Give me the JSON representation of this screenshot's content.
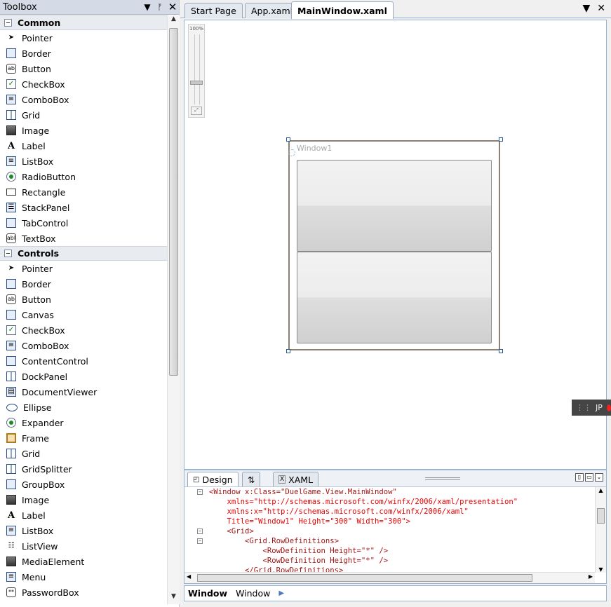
{
  "toolbox": {
    "title": "Toolbox",
    "categories": [
      {
        "name": "Common",
        "items": [
          {
            "label": "Pointer",
            "icon": "pointer-icon"
          },
          {
            "label": "Border",
            "icon": "border-icon"
          },
          {
            "label": "Button",
            "icon": "button-icon"
          },
          {
            "label": "CheckBox",
            "icon": "checkbox-icon"
          },
          {
            "label": "ComboBox",
            "icon": "combobox-icon"
          },
          {
            "label": "Grid",
            "icon": "grid-icon"
          },
          {
            "label": "Image",
            "icon": "image-icon"
          },
          {
            "label": "Label",
            "icon": "label-icon"
          },
          {
            "label": "ListBox",
            "icon": "listbox-icon"
          },
          {
            "label": "RadioButton",
            "icon": "radiobutton-icon"
          },
          {
            "label": "Rectangle",
            "icon": "rectangle-icon"
          },
          {
            "label": "StackPanel",
            "icon": "stackpanel-icon"
          },
          {
            "label": "TabControl",
            "icon": "tabcontrol-icon"
          },
          {
            "label": "TextBox",
            "icon": "textbox-icon"
          }
        ]
      },
      {
        "name": "Controls",
        "items": [
          {
            "label": "Pointer",
            "icon": "pointer-icon"
          },
          {
            "label": "Border",
            "icon": "border-icon"
          },
          {
            "label": "Button",
            "icon": "button-icon"
          },
          {
            "label": "Canvas",
            "icon": "canvas-icon"
          },
          {
            "label": "CheckBox",
            "icon": "checkbox-icon"
          },
          {
            "label": "ComboBox",
            "icon": "combobox-icon"
          },
          {
            "label": "ContentControl",
            "icon": "contentcontrol-icon"
          },
          {
            "label": "DockPanel",
            "icon": "dockpanel-icon"
          },
          {
            "label": "DocumentViewer",
            "icon": "documentviewer-icon"
          },
          {
            "label": "Ellipse",
            "icon": "ellipse-icon"
          },
          {
            "label": "Expander",
            "icon": "expander-icon"
          },
          {
            "label": "Frame",
            "icon": "frame-icon"
          },
          {
            "label": "Grid",
            "icon": "grid-icon"
          },
          {
            "label": "GridSplitter",
            "icon": "gridsplitter-icon"
          },
          {
            "label": "GroupBox",
            "icon": "groupbox-icon"
          },
          {
            "label": "Image",
            "icon": "image-icon"
          },
          {
            "label": "Label",
            "icon": "label-icon"
          },
          {
            "label": "ListBox",
            "icon": "listbox-icon"
          },
          {
            "label": "ListView",
            "icon": "listview-icon"
          },
          {
            "label": "MediaElement",
            "icon": "mediaelement-icon"
          },
          {
            "label": "Menu",
            "icon": "menu-icon"
          },
          {
            "label": "PasswordBox",
            "icon": "passwordbox-icon"
          }
        ]
      }
    ]
  },
  "tabs": [
    {
      "label": "Start Page",
      "active": false
    },
    {
      "label": "App.xaml",
      "active": false
    },
    {
      "label": "MainWindow.xaml",
      "active": true
    }
  ],
  "designer": {
    "zoom_label": "100%",
    "window_title": "Window1"
  },
  "ime": {
    "label": "JP"
  },
  "xaml_pane": {
    "tabs": [
      {
        "label": "Design",
        "icon": "design-icon"
      },
      {
        "label": "⇅",
        "icon": "swap-icon"
      },
      {
        "label": "XAML",
        "icon": "xaml-icon"
      }
    ],
    "code_lines": [
      "<Window x:Class=\"DuelGame.View.MainWindow\"",
      "    xmlns=\"http://schemas.microsoft.com/winfx/2006/xaml/presentation\"",
      "    xmlns:x=\"http://schemas.microsoft.com/winfx/2006/xaml\"",
      "    Title=\"Window1\" Height=\"300\" Width=\"300\">",
      "    <Grid>",
      "        <Grid.RowDefinitions>",
      "            <RowDefinition Height=\"*\" />",
      "            <RowDefinition Height=\"*\" />",
      "        </Grid.RowDefinitions>"
    ]
  },
  "breadcrumb": {
    "element": "Window",
    "name": "Window"
  }
}
